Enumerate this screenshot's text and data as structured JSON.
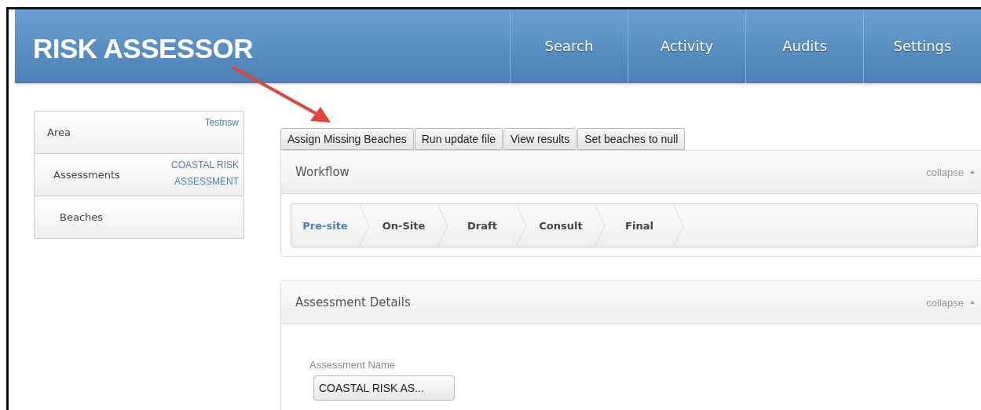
{
  "header": {
    "logo": "RISK ASSESSOR",
    "nav": [
      {
        "label": "Search"
      },
      {
        "label": "Activity"
      },
      {
        "label": "Audits"
      },
      {
        "label": "Settings"
      }
    ]
  },
  "sidebar": {
    "items": [
      {
        "label": "Area",
        "value": "Testnsw",
        "children": [
          {
            "label": "Assessments",
            "value": "COASTAL RISK ASSESSMENT",
            "children": [
              {
                "label": "Beaches"
              }
            ]
          }
        ]
      }
    ]
  },
  "toolbar": {
    "buttons": [
      "Assign Missing Beaches",
      "Run update file",
      "View results",
      "Set beaches to null"
    ]
  },
  "workflow": {
    "title": "Workflow",
    "collapse": "collapse",
    "steps": [
      {
        "label": "Pre-site",
        "selected": true
      },
      {
        "label": "On-Site",
        "selected": false
      },
      {
        "label": "Draft",
        "selected": false
      },
      {
        "label": "Consult",
        "selected": false
      },
      {
        "label": "Final",
        "selected": false
      }
    ]
  },
  "details": {
    "title": "Assessment Details",
    "collapse": "collapse",
    "field_label": "Assessment Name",
    "field_value": "COASTAL RISK AS..."
  }
}
